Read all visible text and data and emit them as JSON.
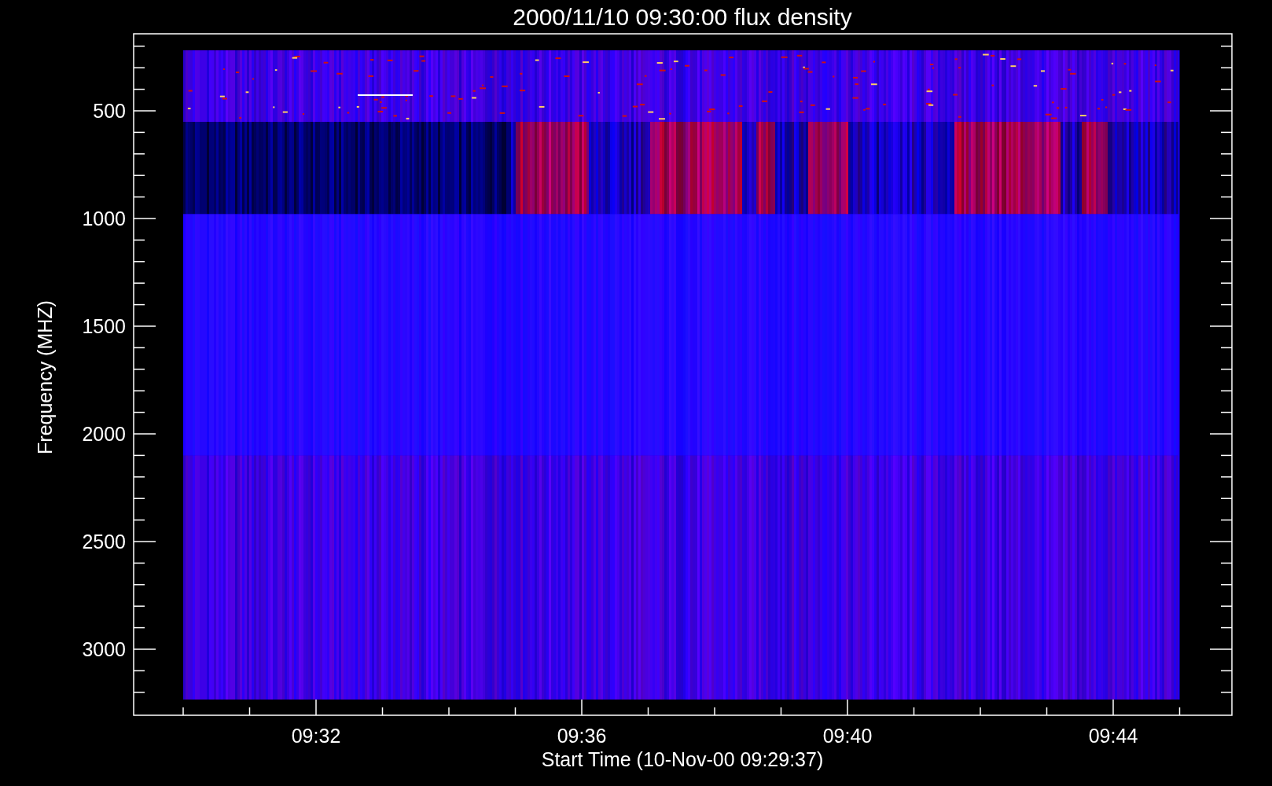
{
  "title": "2000/11/10 09:30:00 flux density",
  "y_axis": {
    "label": "Frequency (MHZ)",
    "ticks": [
      "500",
      "1000",
      "1500",
      "2000",
      "2500",
      "3000"
    ]
  },
  "x_axis": {
    "label": "Start Time (10-Nov-00 09:29:37)",
    "ticks": [
      "09:32",
      "09:36",
      "09:40",
      "09:44"
    ]
  }
}
